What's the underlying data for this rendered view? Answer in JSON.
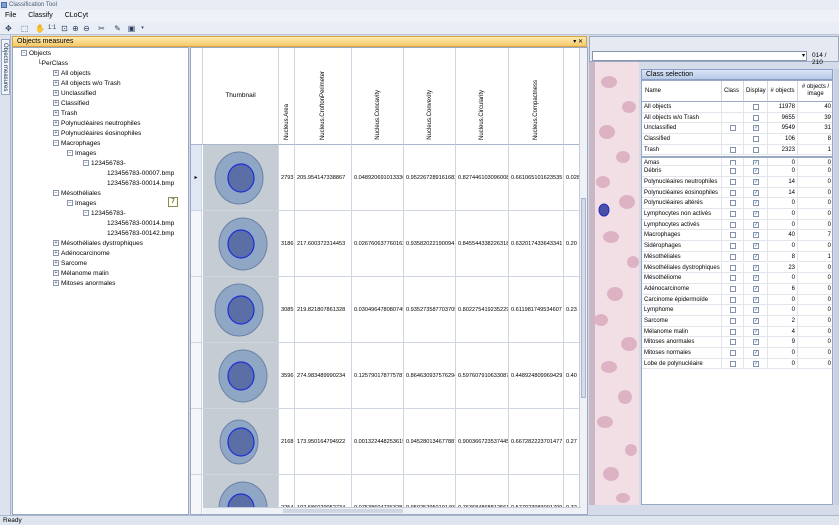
{
  "window": {
    "title": "Classification Tool"
  },
  "menu": [
    "File",
    "Classify",
    "CLoCyt"
  ],
  "toolbar": {
    "zoom_label": "1:1"
  },
  "sidebar_tab": "Objects measures",
  "panel": {
    "title": "Objects measures"
  },
  "tree": {
    "root": "Objects",
    "perclass": "PerClass",
    "items": [
      "All objects",
      "All objects w/o Trash",
      "Unclassified",
      "Classified",
      "Trash",
      "Polynucléaires neutrophiles",
      "Polynucléaires éosinophiles",
      "Macrophages"
    ],
    "images_label": "Images",
    "macro_group": "123456783-",
    "macro_files": [
      "123456783-00007.bmp",
      "123456783-00014.bmp"
    ],
    "meso": "Mésothéliales",
    "meso_group": "123456783-",
    "meso_files": [
      "123456783-00014.bmp",
      "123456783-00142.bmp"
    ],
    "badge": "7",
    "tail_items": [
      "Mésothéliales dystrophiques",
      "Adénocarcinome",
      "Sarcome",
      "Mélanome malin",
      "Mitoses anormales"
    ]
  },
  "grid": {
    "thumbnail_header": "Thumbnail",
    "columns": [
      "Nucleus.Area",
      "Nucleus.CroftonPerimeter",
      "Nucleus.Concavity",
      "Nucleus.Convexity",
      "Nucleus.Circularity",
      "Nucleus.Compactness"
    ],
    "rows": [
      [
        "2793",
        "205.954147338867",
        "0.0489206910133362",
        "0.952267289161682",
        "0.827446103096008",
        "0.661065101623535",
        "0.028"
      ],
      [
        "3186",
        "217.600372314453",
        "0.0267606377601624",
        "0.93582022190094",
        "0.845544338226318",
        "0.632017433643341",
        "0.20"
      ],
      [
        "3085",
        "219.821807861328",
        "0.0304964780807495",
        "0.935273587703705",
        "0.802275419235229",
        "0.611981749534607",
        "0.23"
      ],
      [
        "3596",
        "274.983489990234",
        "0.125790178775787",
        "0.864630937576294",
        "0.597607910633087",
        "0.448924809969429",
        "0.40"
      ],
      [
        "2168",
        "173.950164794922",
        "0.0013224482536159",
        "0.945280134677887",
        "0.900366723537445",
        "0.667282223701477",
        "0.27"
      ],
      [
        "2254",
        "192.586029052734",
        "0.0753860473632813",
        "0.950252950191498",
        "0.763684868812561",
        "0.577023983001709",
        "0.32"
      ]
    ]
  },
  "viewer": {
    "page": "014 / 210"
  },
  "class_selection": {
    "title": "Class selection",
    "headers": {
      "name": "Name",
      "class": "Class",
      "display": "Display",
      "objects": "# objects",
      "per_image": "# objects / image"
    },
    "rows": [
      {
        "name": "All objects",
        "class": "",
        "display": "off",
        "objects": "11978",
        "per_image": "40"
      },
      {
        "name": "All objects w/o Trash",
        "class": "",
        "display": "off",
        "objects": "9655",
        "per_image": "39"
      },
      {
        "name": "Unclassified",
        "class": "off",
        "display": "on",
        "objects": "9549",
        "per_image": "31"
      },
      {
        "name": "Classified",
        "class": "",
        "display": "off",
        "objects": "106",
        "per_image": "8"
      },
      {
        "name": "Trash",
        "class": "off",
        "display": "off",
        "objects": "2323",
        "per_image": "1"
      },
      {
        "name": "Amas",
        "class": "off",
        "display": "on",
        "objects": "0",
        "per_image": "0"
      },
      {
        "name": "Débris",
        "class": "off",
        "display": "on",
        "objects": "0",
        "per_image": "0"
      },
      {
        "name": "Polynucléaires neutrophiles",
        "class": "off",
        "display": "on",
        "objects": "14",
        "per_image": "0"
      },
      {
        "name": "Polynucléaires éosinophiles",
        "class": "off",
        "display": "on",
        "objects": "14",
        "per_image": "0"
      },
      {
        "name": "Polynucléaires altérés",
        "class": "off",
        "display": "on",
        "objects": "0",
        "per_image": "0"
      },
      {
        "name": "Lymphocytes non activés",
        "class": "off",
        "display": "on",
        "objects": "0",
        "per_image": "0"
      },
      {
        "name": "Lymphocytes activés",
        "class": "off",
        "display": "on",
        "objects": "0",
        "per_image": "0"
      },
      {
        "name": "Macrophages",
        "class": "off",
        "display": "on",
        "objects": "40",
        "per_image": "7"
      },
      {
        "name": "Sidérophages",
        "class": "off",
        "display": "on",
        "objects": "0",
        "per_image": "0"
      },
      {
        "name": "Mésothéliales",
        "class": "off",
        "display": "on",
        "objects": "8",
        "per_image": "1"
      },
      {
        "name": "Mésothéliales dystrophiques",
        "class": "off",
        "display": "on",
        "objects": "23",
        "per_image": "0"
      },
      {
        "name": "Mésothéliome",
        "class": "off",
        "display": "on",
        "objects": "0",
        "per_image": "0"
      },
      {
        "name": "Adénocarcinome",
        "class": "off",
        "display": "on",
        "objects": "6",
        "per_image": "0"
      },
      {
        "name": "Carcinome épidermoïde",
        "class": "off",
        "display": "on",
        "objects": "0",
        "per_image": "0"
      },
      {
        "name": "Lymphome",
        "class": "off",
        "display": "on",
        "objects": "0",
        "per_image": "0"
      },
      {
        "name": "Sarcome",
        "class": "off",
        "display": "on",
        "objects": "2",
        "per_image": "0"
      },
      {
        "name": "Mélanome malin",
        "class": "off",
        "display": "on",
        "objects": "4",
        "per_image": "0"
      },
      {
        "name": "Mitoses anormales",
        "class": "off",
        "display": "on",
        "objects": "9",
        "per_image": "0"
      },
      {
        "name": "Mitoses normales",
        "class": "off",
        "display": "on",
        "objects": "0",
        "per_image": "0"
      },
      {
        "name": "Lobe de polynucléaire",
        "class": "off",
        "display": "on",
        "objects": "0",
        "per_image": "0"
      }
    ]
  },
  "status": "Ready"
}
